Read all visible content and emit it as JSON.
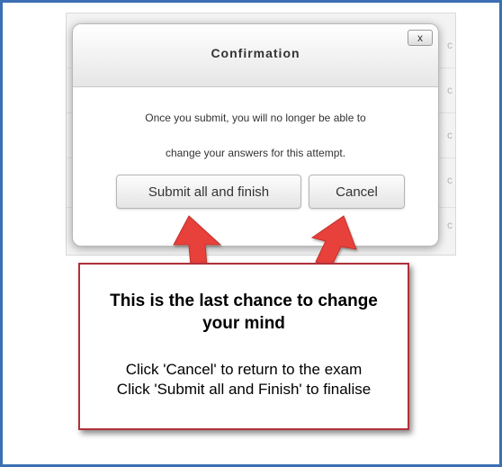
{
  "dialog": {
    "title": "Confirmation",
    "close_label": "x",
    "message_line1": "Once you submit, you will no longer be able to",
    "message_line2": "change your answers for this attempt.",
    "submit_label": "Submit all and finish",
    "cancel_label": "Cancel"
  },
  "background": {
    "letters": [
      "c",
      "c",
      "c",
      "c",
      "c"
    ]
  },
  "callout": {
    "heading_line1": "This is the last chance to change",
    "heading_line2": "your mind",
    "instruction_line1": "Click 'Cancel' to return to the exam",
    "instruction_line2": "Click 'Submit all and Finish' to finalise"
  },
  "colors": {
    "frame_border": "#3c6fb4",
    "callout_border": "#b0303a",
    "arrow_fill": "#e8403b"
  }
}
